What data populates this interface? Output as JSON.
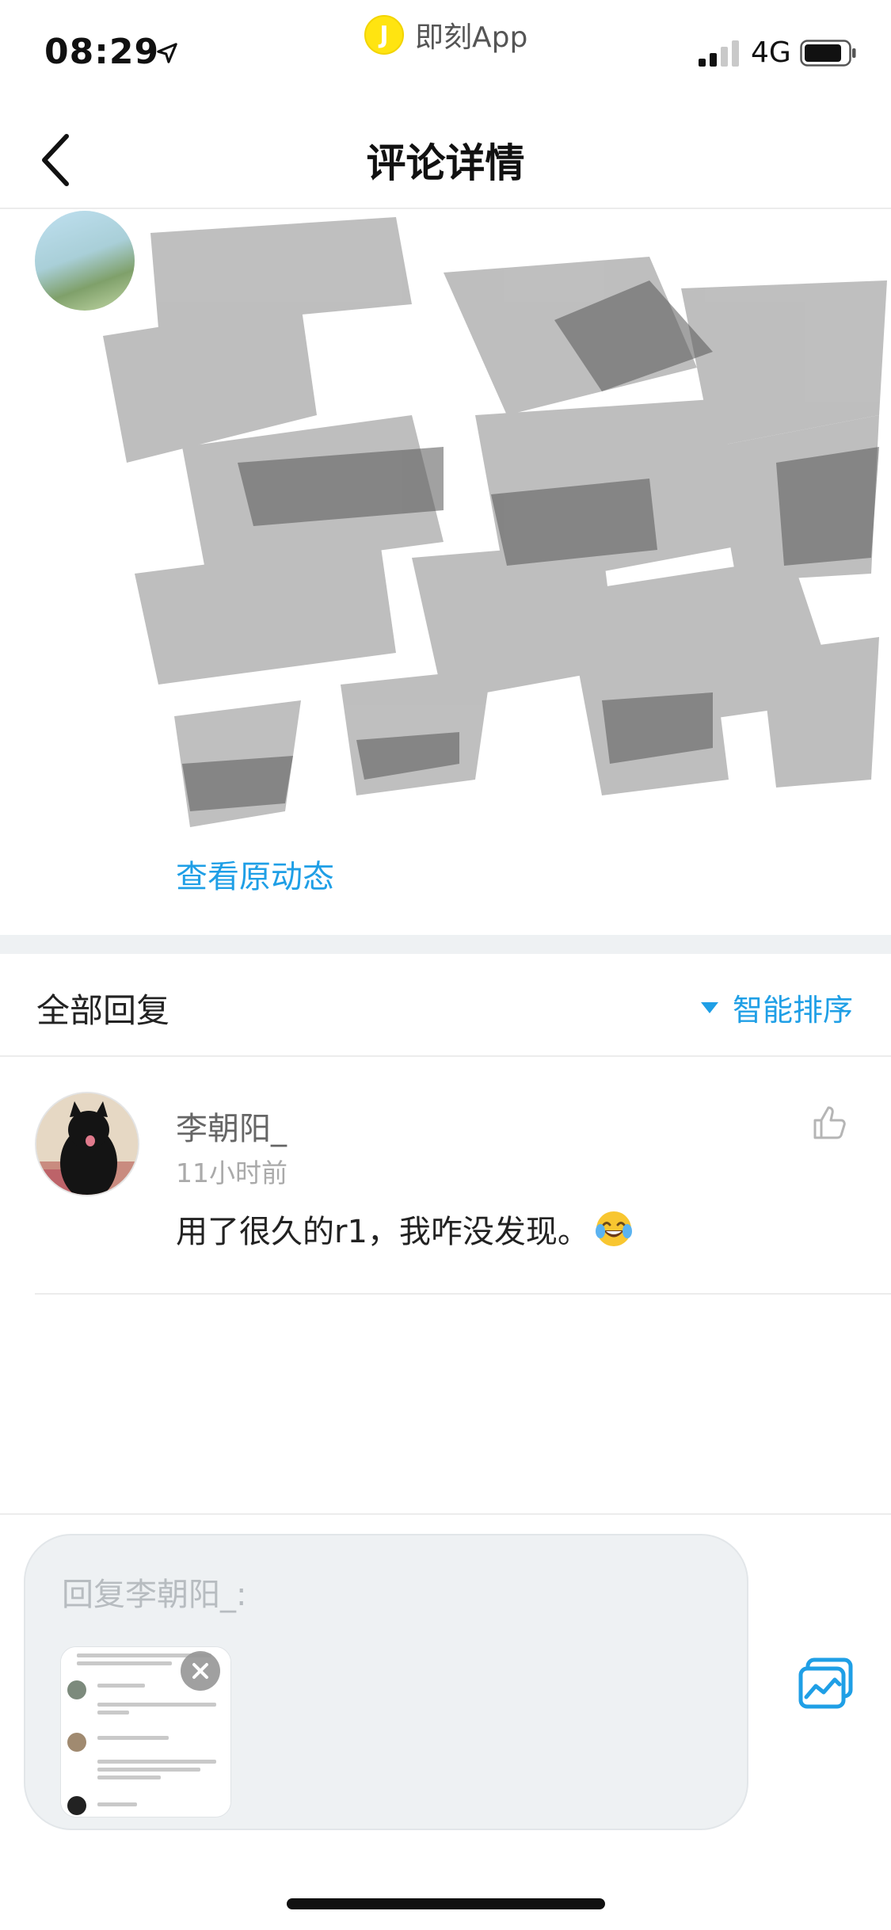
{
  "status_bar": {
    "time": "08:29",
    "app_name": "即刻App",
    "app_logo_letter": "J",
    "network": "4G"
  },
  "nav": {
    "title": "评论详情"
  },
  "post": {
    "view_original_label": "查看原动态"
  },
  "replies": {
    "header_title": "全部回复",
    "sort_label": "智能排序",
    "items": [
      {
        "author": "李朝阳_",
        "time": "11小时前",
        "text": "用了很久的r1，我咋没发现。"
      }
    ]
  },
  "composer": {
    "placeholder": "回复李朝阳_:"
  },
  "colors": {
    "accent": "#1f9fe6",
    "logo_yellow": "#ffe411",
    "separator": "#eef1f3"
  },
  "icons": {
    "back": "chevron-left-icon",
    "location": "location-arrow-icon",
    "like": "thumbs-up-icon",
    "image": "image-picker-icon",
    "close": "close-icon"
  }
}
